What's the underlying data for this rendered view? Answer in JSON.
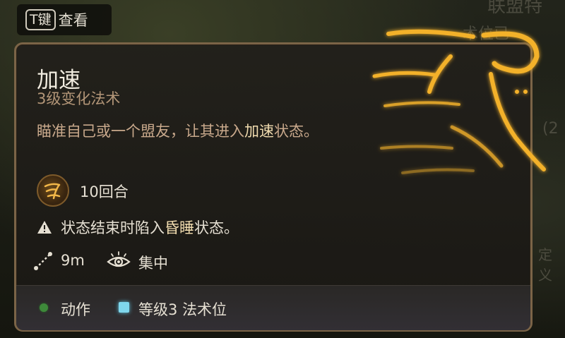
{
  "background": {
    "top_right_text": "联盟特",
    "right_text_1": "术位已",
    "right_text_2": "(2",
    "right_text_3": "定义"
  },
  "hint": {
    "key": "T键",
    "label": "查看"
  },
  "spell": {
    "name": "加速",
    "level_school": "3级变化法术",
    "desc_prefix": "瞄准自己或一个盟友，让其进入",
    "desc_highlight": "加速",
    "desc_suffix": "状态。",
    "duration": "10回合",
    "warning_prefix": "状态结束时陷入",
    "warning_highlight": "昏睡",
    "warning_suffix": "状态。",
    "range": "9m",
    "concentration": "集中"
  },
  "footer": {
    "action": "动作",
    "slot": "等级3 法术位"
  },
  "colors": {
    "frame": "#7b6447",
    "highlight_text": "#f1dcaf",
    "action_dot": "#3e8a3a",
    "slot_square": "#7fd6ec",
    "glow": "#f3b12c"
  },
  "icons": [
    "spell-haste-art",
    "haste-duration-icon",
    "warning-icon",
    "range-icon",
    "concentration-eye-icon"
  ]
}
